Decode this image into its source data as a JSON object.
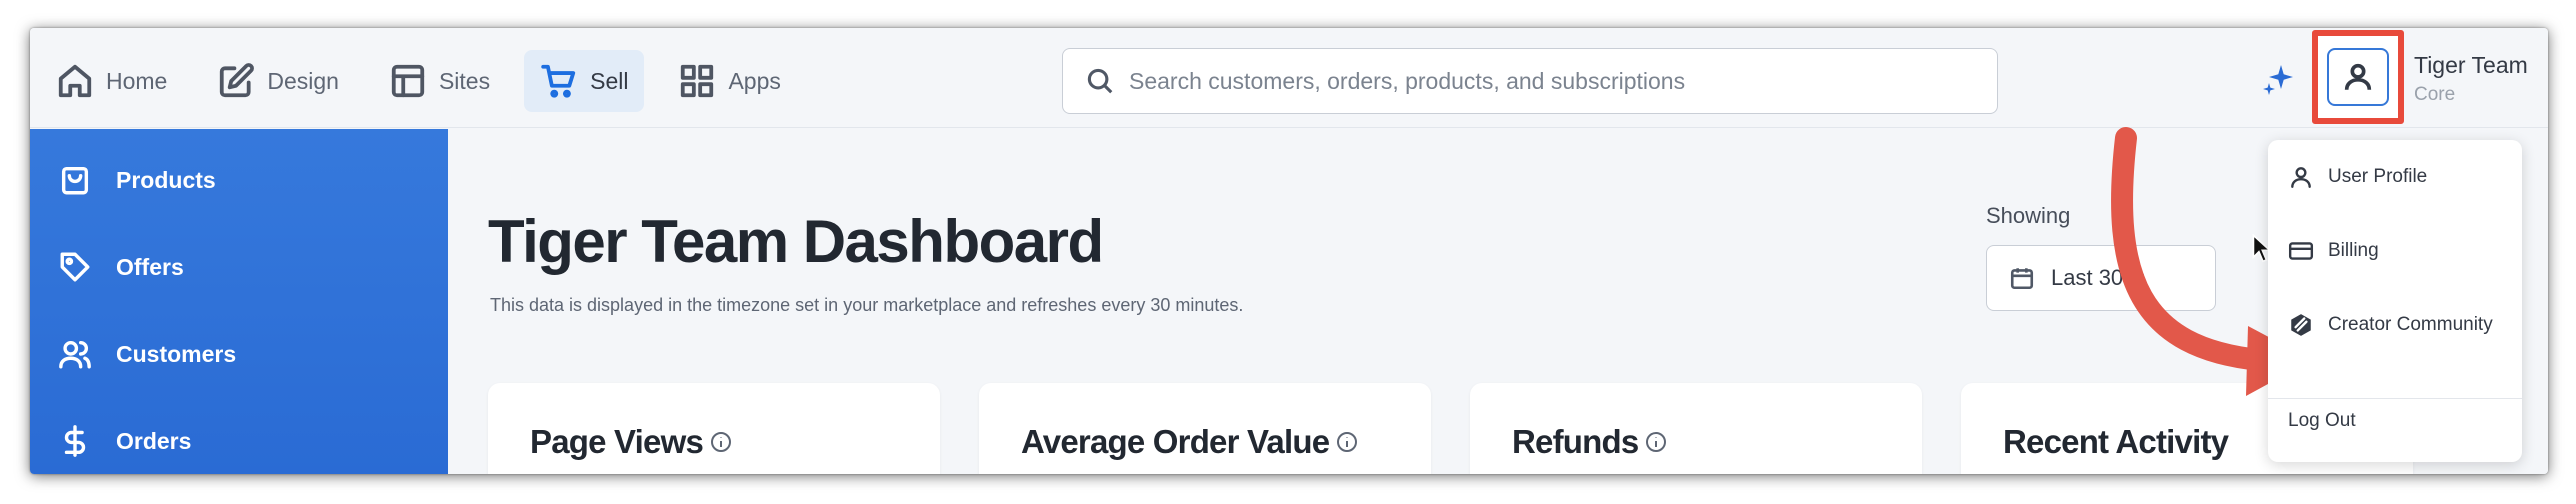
{
  "nav": {
    "items": [
      {
        "label": "Home",
        "icon": "home-icon",
        "active": false
      },
      {
        "label": "Design",
        "icon": "pencil-square-icon",
        "active": false
      },
      {
        "label": "Sites",
        "icon": "layout-icon",
        "active": false
      },
      {
        "label": "Sell",
        "icon": "cart-icon",
        "active": true
      },
      {
        "label": "Apps",
        "icon": "grid-icon",
        "active": false
      }
    ]
  },
  "search": {
    "placeholder": "Search customers, orders, products, and subscriptions"
  },
  "user": {
    "name": "Tiger Team",
    "plan": "Core"
  },
  "sidebar": {
    "items": [
      {
        "label": "Products",
        "icon": "shopping-bag-icon"
      },
      {
        "label": "Offers",
        "icon": "tag-icon"
      },
      {
        "label": "Customers",
        "icon": "users-icon"
      },
      {
        "label": "Orders",
        "icon": "dollar-icon"
      }
    ]
  },
  "main": {
    "title": "Tiger Team Dashboard",
    "subtitle": "This data is displayed in the timezone set in your marketplace and refreshes every 30 minutes.",
    "showing_label": "Showing",
    "date_range": "Last 30 D"
  },
  "cards": [
    {
      "title": "Page Views",
      "info": true
    },
    {
      "title": "Average Order Value",
      "info": true
    },
    {
      "title": "Refunds",
      "info": true
    },
    {
      "title": "Recent Activity",
      "info": false
    }
  ],
  "user_menu": {
    "items": [
      {
        "label": "User Profile",
        "icon": "user-icon"
      },
      {
        "label": "Billing",
        "icon": "credit-card-icon"
      },
      {
        "label": "Creator Community",
        "icon": "community-logo-icon"
      }
    ],
    "logout": "Log Out"
  },
  "colors": {
    "accent": "#2a6bd4",
    "highlight": "#e84a3b",
    "annotation_arrow": "#e2584a"
  }
}
